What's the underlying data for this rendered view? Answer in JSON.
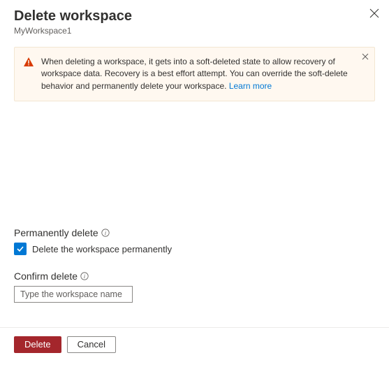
{
  "header": {
    "title": "Delete workspace",
    "subtitle": "MyWorkspace1"
  },
  "warning": {
    "text": "When deleting a workspace, it gets into a soft-deleted state to allow recovery of workspace data. Recovery is a best effort attempt. You can override the soft-delete behavior and permanently delete your workspace. ",
    "learn_more": "Learn more"
  },
  "form": {
    "perm_label": "Permanently delete",
    "checkbox_label": "Delete the workspace permanently",
    "checkbox_checked": true,
    "confirm_label": "Confirm delete",
    "input_placeholder": "Type the workspace name",
    "input_value": ""
  },
  "footer": {
    "delete": "Delete",
    "cancel": "Cancel"
  }
}
